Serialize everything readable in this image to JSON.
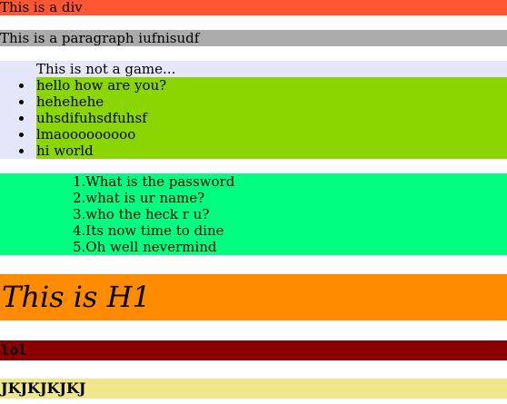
{
  "colors": {
    "div_bg": "#FF5733",
    "paragraph_bg": "#ABABAB",
    "game_bg": "#E6E6FA",
    "list_item_bg": "#8BD600",
    "questions_bg": "#00FF80",
    "h1_bg": "#FF8C00",
    "lol_bg": "#8B0000",
    "jk_bg": "#F0E68C"
  },
  "div_text": "This is a div",
  "paragraph_text": "This is a paragraph iufnisudf",
  "game": {
    "title": "This is not a game...",
    "items": [
      "hello how are you?",
      "hehehehe",
      "uhsdifuhsdfuhsf",
      "lmaooooooooo",
      "hi world"
    ]
  },
  "questions": [
    "1.What is the password",
    "2.what is ur name?",
    "3.who the heck r u?",
    "4.Its now time to dine",
    "5.Oh well nevermind"
  ],
  "heading": "This is H1",
  "lol_text": "lol",
  "jk_text": "JKJKJKJKJ"
}
